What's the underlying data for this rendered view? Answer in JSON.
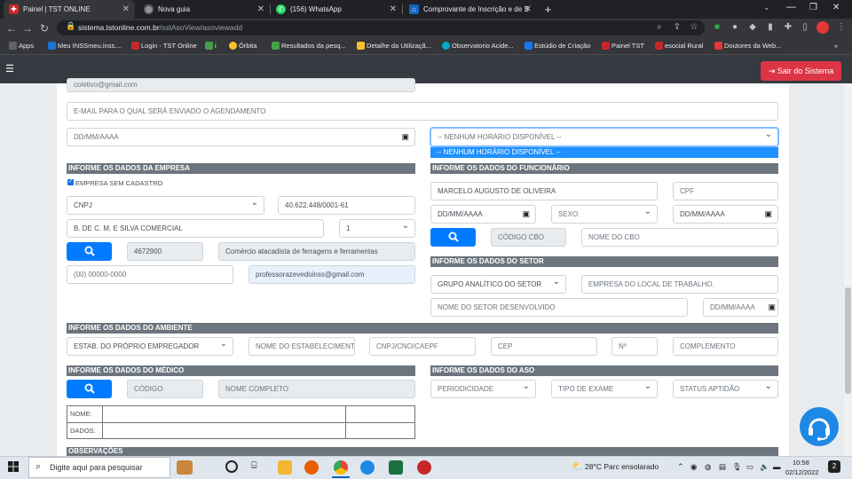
{
  "browser": {
    "tabs": [
      {
        "title": "Painel | TST ONLINE",
        "active": true
      },
      {
        "title": "Nova guia",
        "active": false
      },
      {
        "title": "(156) WhatsApp",
        "active": false
      },
      {
        "title": "Comprovante de Inscrição e de S",
        "active": false
      }
    ],
    "url_host": "sistema.tstonline.com.br",
    "url_path": "/sstAsoView/asoviewadd",
    "bookmarks": [
      "Apps",
      "Meu INSSmeu.inss....",
      "Login - TST Online",
      "i",
      "Órbita",
      "Resultados da pesq...",
      "Detalhe da Utilizaçã...",
      "Observatorio Acide...",
      "Estúdio de Criação",
      "Painel TST",
      "esocial Rural",
      "Doutores da Web..."
    ],
    "more_bookmarks": "»"
  },
  "app": {
    "logout_label": "Sair do Sistema"
  },
  "form": {
    "email_value": "coletivo@gmail.com",
    "email_schedule_placeholder": "E-MAIL PARA O QUAL SERÁ ENVIADO O AGENDAMENTO",
    "date_placeholder": "DD/MM/AAAA",
    "horario_select": "-- NENHUM HORÁRIO DISPONÍVEL --",
    "horario_option": "-- NENHUM HORÁRIO DISPONÍVEL --",
    "empresa": {
      "header": "INFORME OS DADOS DA EMPRESA",
      "checkbox_label": "EMPRESA SEM CADASTRO",
      "doc_type": "CNPJ",
      "doc_number": "40.622.448/0001-61",
      "razao_social": "B. DE C. M. E SILVA COMERCIAL",
      "unidade": "1",
      "cnae_code": "4672900",
      "cnae_desc": "Comércio atacadista de ferragens e ferramentas",
      "phone_placeholder": "(00) 00000-0000",
      "email": "professorazevedoinss@gmail.com"
    },
    "funcionario": {
      "header": "INFORME OS DADOS DO FUNCIONÁRIO",
      "nome": "MARCELO AUGUSTO DE OLIVEIRA",
      "cpf_placeholder": "CPF",
      "nascimento_placeholder": "DD/MM/AAAA",
      "sexo": "SEXO",
      "admissao_placeholder": "DD/MM/AAAA",
      "cbo_code_placeholder": "CÓDIGO CBO",
      "cbo_name_placeholder": "NOME DO CBO"
    },
    "setor": {
      "header": "INFORME OS DADOS DO SETOR",
      "grupo": "GRUPO ANALÍTICO DO SETOR",
      "empresa_local_placeholder": "EMPRESA DO LOCAL DE TRABALHO.",
      "nome_setor_placeholder": "NOME DO SETOR DESENVOLVIDO",
      "data_placeholder": "DD/MM/AAAA"
    },
    "ambiente": {
      "header": "INFORME OS DADOS DO AMBIENTE",
      "estab": "ESTAB. DO PRÓPRIO EMPREGADOR",
      "nome_estab_placeholder": "NOME DO ESTABELECIMENTO",
      "cnpj_placeholder": "CNPJ/CNO/CAEPF",
      "cep_placeholder": "CEP",
      "numero_placeholder": "Nº",
      "complemento_placeholder": "COMPLEMENTO"
    },
    "medico": {
      "header": "INFORME OS DADOS DO MÉDICO",
      "codigo_placeholder": "CÓDIGO",
      "nome_placeholder": "NOME COMPLETO",
      "table_nome": "NOME:",
      "table_dados": "DADOS:"
    },
    "aso": {
      "header": "INFORME OS DADOS DO ASO",
      "periodicidade": "PERIODICIDADE",
      "tipo_exame": "TIPO DE EXAME",
      "status_aptidao": "STATUS APTIDÃO"
    },
    "observacoes_header": "OBSERVAÇÕES"
  },
  "taskbar": {
    "search_placeholder": "Digite aqui para pesquisar",
    "weather": "28°C  Parc ensolarado",
    "time": "10:58",
    "date": "02/12/2022",
    "notifications": "2"
  }
}
